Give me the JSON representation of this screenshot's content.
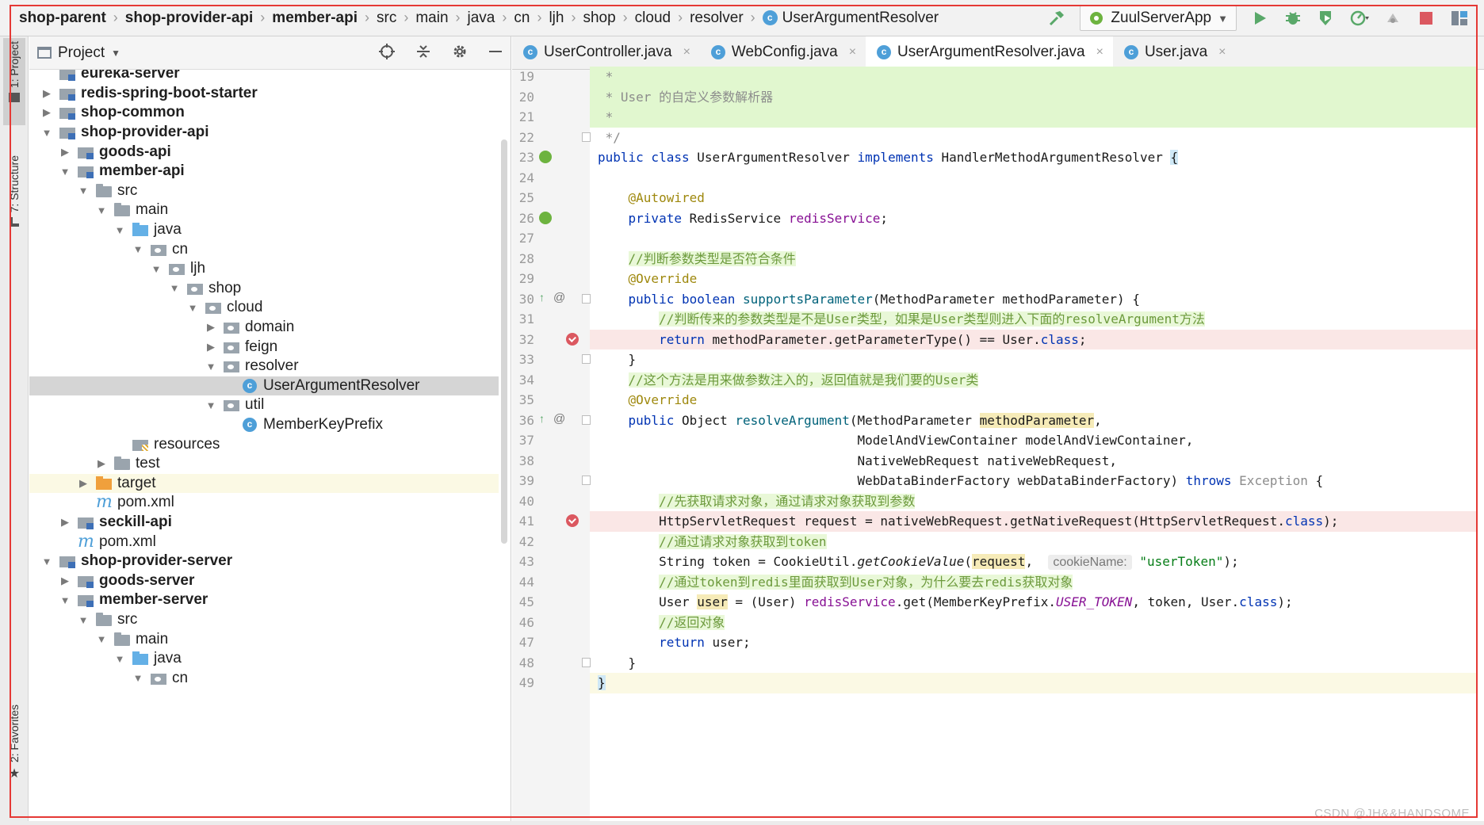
{
  "breadcrumb": [
    {
      "label": "shop-parent",
      "bold": true
    },
    {
      "label": "shop-provider-api",
      "bold": true
    },
    {
      "label": "member-api",
      "bold": true
    },
    {
      "label": "src",
      "bold": false
    },
    {
      "label": "main",
      "bold": false
    },
    {
      "label": "java",
      "bold": false
    },
    {
      "label": "cn",
      "bold": false
    },
    {
      "label": "ljh",
      "bold": false
    },
    {
      "label": "shop",
      "bold": false
    },
    {
      "label": "cloud",
      "bold": false
    },
    {
      "label": "resolver",
      "bold": false
    },
    {
      "label": "UserArgumentResolver",
      "bold": false,
      "icon": "class-icon"
    }
  ],
  "run_config": {
    "label": "ZuulServerApp"
  },
  "left_strip": {
    "project": "1: Project",
    "structure": "7: Structure",
    "favorites": "2: Favorites"
  },
  "project_panel": {
    "title": "Project"
  },
  "tree": [
    {
      "label": "eureka-server",
      "depth": 1,
      "icon": "module",
      "arrow": "",
      "bold": true
    },
    {
      "label": "redis-spring-boot-starter",
      "depth": 1,
      "icon": "module",
      "arrow": "▶",
      "bold": true
    },
    {
      "label": "shop-common",
      "depth": 1,
      "icon": "module",
      "arrow": "▶",
      "bold": true
    },
    {
      "label": "shop-provider-api",
      "depth": 1,
      "icon": "module",
      "arrow": "▼",
      "bold": true
    },
    {
      "label": "goods-api",
      "depth": 2,
      "icon": "module",
      "arrow": "▶",
      "bold": true
    },
    {
      "label": "member-api",
      "depth": 2,
      "icon": "module",
      "arrow": "▼",
      "bold": true
    },
    {
      "label": "src",
      "depth": 3,
      "icon": "folder",
      "arrow": "▼",
      "bold": false
    },
    {
      "label": "main",
      "depth": 4,
      "icon": "folder",
      "arrow": "▼",
      "bold": false
    },
    {
      "label": "java",
      "depth": 5,
      "icon": "src",
      "arrow": "▼",
      "bold": false
    },
    {
      "label": "cn",
      "depth": 6,
      "icon": "pkg",
      "arrow": "▼",
      "bold": false
    },
    {
      "label": "ljh",
      "depth": 7,
      "icon": "pkg",
      "arrow": "▼",
      "bold": false
    },
    {
      "label": "shop",
      "depth": 8,
      "icon": "pkg",
      "arrow": "▼",
      "bold": false
    },
    {
      "label": "cloud",
      "depth": 9,
      "icon": "pkg",
      "arrow": "▼",
      "bold": false
    },
    {
      "label": "domain",
      "depth": 10,
      "icon": "pkg",
      "arrow": "▶",
      "bold": false
    },
    {
      "label": "feign",
      "depth": 10,
      "icon": "pkg",
      "arrow": "▶",
      "bold": false
    },
    {
      "label": "resolver",
      "depth": 10,
      "icon": "pkg",
      "arrow": "▼",
      "bold": false
    },
    {
      "label": "UserArgumentResolver",
      "depth": 11,
      "icon": "cls",
      "arrow": "",
      "bold": false,
      "selected": true
    },
    {
      "label": "util",
      "depth": 10,
      "icon": "pkg",
      "arrow": "▼",
      "bold": false
    },
    {
      "label": "MemberKeyPrefix",
      "depth": 11,
      "icon": "cls",
      "arrow": "",
      "bold": false
    },
    {
      "label": "resources",
      "depth": 5,
      "icon": "res",
      "arrow": "",
      "bold": false
    },
    {
      "label": "test",
      "depth": 4,
      "icon": "folder",
      "arrow": "▶",
      "bold": false
    },
    {
      "label": "target",
      "depth": 3,
      "icon": "orange",
      "arrow": "▶",
      "bold": false,
      "target": true
    },
    {
      "label": "pom.xml",
      "depth": 3,
      "icon": "mvn",
      "arrow": "",
      "bold": false
    },
    {
      "label": "seckill-api",
      "depth": 2,
      "icon": "module",
      "arrow": "▶",
      "bold": true
    },
    {
      "label": "pom.xml",
      "depth": 2,
      "icon": "mvn",
      "arrow": "",
      "bold": false
    },
    {
      "label": "shop-provider-server",
      "depth": 1,
      "icon": "module",
      "arrow": "▼",
      "bold": true
    },
    {
      "label": "goods-server",
      "depth": 2,
      "icon": "module",
      "arrow": "▶",
      "bold": true
    },
    {
      "label": "member-server",
      "depth": 2,
      "icon": "module",
      "arrow": "▼",
      "bold": true
    },
    {
      "label": "src",
      "depth": 3,
      "icon": "folder",
      "arrow": "▼",
      "bold": false
    },
    {
      "label": "main",
      "depth": 4,
      "icon": "folder",
      "arrow": "▼",
      "bold": false
    },
    {
      "label": "java",
      "depth": 5,
      "icon": "src",
      "arrow": "▼",
      "bold": false
    },
    {
      "label": "cn",
      "depth": 6,
      "icon": "pkg",
      "arrow": "▼",
      "bold": false
    }
  ],
  "tabs": [
    {
      "label": "UserController.java",
      "active": false
    },
    {
      "label": "WebConfig.java",
      "active": false
    },
    {
      "label": "UserArgumentResolver.java",
      "active": true
    },
    {
      "label": "User.java",
      "active": false
    }
  ],
  "code_lines": [
    {
      "n": "19",
      "bg": "green",
      "parts": [
        [
          "cm",
          " *"
        ]
      ]
    },
    {
      "n": "20",
      "bg": "green",
      "parts": [
        [
          "cm",
          " * User 的自定义参数解析器"
        ]
      ]
    },
    {
      "n": "21",
      "bg": "green",
      "parts": [
        [
          "cm",
          " *"
        ]
      ]
    },
    {
      "n": "22",
      "bg": "",
      "fold": true,
      "parts": [
        [
          "cm",
          " */"
        ]
      ]
    },
    {
      "n": "23",
      "bg": "",
      "gicon": "bean",
      "parts": [
        [
          "kw",
          "public class "
        ],
        [
          "",
          "UserArgumentResolver "
        ],
        [
          "kw",
          "implements "
        ],
        [
          "",
          "HandlerMethodArgumentResolver "
        ],
        [
          "brace",
          "{"
        ]
      ]
    },
    {
      "n": "24",
      "bg": "",
      "parts": []
    },
    {
      "n": "25",
      "bg": "",
      "parts": [
        [
          "",
          "    "
        ],
        [
          "an",
          "@Autowired"
        ]
      ]
    },
    {
      "n": "26",
      "bg": "",
      "gicon": "bean",
      "parts": [
        [
          "",
          "    "
        ],
        [
          "kw",
          "private "
        ],
        [
          "",
          "RedisService "
        ],
        [
          "fld",
          "redisService"
        ],
        [
          "",
          ";"
        ]
      ]
    },
    {
      "n": "27",
      "bg": "",
      "parts": []
    },
    {
      "n": "28",
      "bg": "",
      "parts": [
        [
          "",
          "    "
        ],
        [
          "cmg",
          "//判断参数类型是否符合条件"
        ]
      ]
    },
    {
      "n": "29",
      "bg": "",
      "parts": [
        [
          "",
          "    "
        ],
        [
          "an",
          "@Override"
        ]
      ]
    },
    {
      "n": "30",
      "bg": "",
      "gicon": "override",
      "fold": true,
      "parts": [
        [
          "",
          "    "
        ],
        [
          "kw",
          "public boolean "
        ],
        [
          "fn",
          "supportsParameter"
        ],
        [
          "",
          "(MethodParameter methodParameter) {"
        ]
      ]
    },
    {
      "n": "31",
      "bg": "",
      "parts": [
        [
          "",
          "        "
        ],
        [
          "cmg",
          "//判断传来的参数类型是不是User类型，如果是User类型则进入下面的resolveArgument方法"
        ]
      ]
    },
    {
      "n": "32",
      "bg": "red",
      "bp": true,
      "parts": [
        [
          "",
          "        "
        ],
        [
          "kw",
          "return "
        ],
        [
          "",
          "methodParameter.getParameterType() == User."
        ],
        [
          "kw",
          "class"
        ],
        [
          "",
          ";"
        ]
      ]
    },
    {
      "n": "33",
      "bg": "",
      "fold": true,
      "parts": [
        [
          "",
          "    }"
        ]
      ]
    },
    {
      "n": "34",
      "bg": "",
      "parts": [
        [
          "",
          "    "
        ],
        [
          "cmg",
          "//这个方法是用来做参数注入的，返回值就是我们要的User类"
        ]
      ]
    },
    {
      "n": "35",
      "bg": "",
      "parts": [
        [
          "",
          "    "
        ],
        [
          "an",
          "@Override"
        ]
      ]
    },
    {
      "n": "36",
      "bg": "",
      "gicon": "override",
      "fold": true,
      "parts": [
        [
          "",
          "    "
        ],
        [
          "kw",
          "public "
        ],
        [
          "",
          "Object "
        ],
        [
          "fn",
          "resolveArgument"
        ],
        [
          "",
          "(MethodParameter "
        ],
        [
          "hly",
          "methodParameter"
        ],
        [
          "",
          ","
        ]
      ]
    },
    {
      "n": "37",
      "bg": "",
      "parts": [
        [
          "",
          "                                  ModelAndViewContainer modelAndViewContainer,"
        ]
      ]
    },
    {
      "n": "38",
      "bg": "",
      "parts": [
        [
          "",
          "                                  NativeWebRequest nativeWebRequest,"
        ]
      ]
    },
    {
      "n": "39",
      "bg": "",
      "fold": true,
      "parts": [
        [
          "",
          "                                  WebDataBinderFactory webDataBinderFactory) "
        ],
        [
          "kw",
          "throws "
        ],
        [
          "cm",
          "Exception "
        ],
        [
          "",
          "{"
        ]
      ]
    },
    {
      "n": "40",
      "bg": "",
      "parts": [
        [
          "",
          "        "
        ],
        [
          "cmg",
          "//先获取请求对象，通过请求对象获取到参数"
        ]
      ]
    },
    {
      "n": "41",
      "bg": "red",
      "bp": true,
      "parts": [
        [
          "",
          "        HttpServletRequest request = nativeWebRequest.getNativeRequest(HttpServletRequest."
        ],
        [
          "kw",
          "class"
        ],
        [
          "",
          ");"
        ]
      ]
    },
    {
      "n": "42",
      "bg": "",
      "parts": [
        [
          "",
          "        "
        ],
        [
          "cmg",
          "//通过请求对象获取到token"
        ]
      ]
    },
    {
      "n": "43",
      "bg": "",
      "parts": [
        [
          "",
          "        String token = CookieUtil."
        ],
        [
          "it",
          "getCookieValue"
        ],
        [
          "",
          "("
        ],
        [
          "hly",
          "request"
        ],
        [
          "",
          ",  "
        ],
        [
          "hint",
          "cookieName:"
        ],
        [
          "",
          " "
        ],
        [
          "str",
          "\"userToken\""
        ],
        [
          "",
          ");"
        ]
      ]
    },
    {
      "n": "44",
      "bg": "",
      "parts": [
        [
          "",
          "        "
        ],
        [
          "cmg",
          "//通过token到redis里面获取到User对象，为什么要去redis获取对象"
        ]
      ]
    },
    {
      "n": "45",
      "bg": "",
      "parts": [
        [
          "",
          "        User "
        ],
        [
          "hly",
          "user"
        ],
        [
          "",
          " = (User) "
        ],
        [
          "fld",
          "redisService"
        ],
        [
          "",
          ".get(MemberKeyPrefix."
        ],
        [
          "st",
          "USER_TOKEN"
        ],
        [
          "",
          ", token, User."
        ],
        [
          "kw",
          "class"
        ],
        [
          "",
          ");"
        ]
      ]
    },
    {
      "n": "46",
      "bg": "",
      "parts": [
        [
          "",
          "        "
        ],
        [
          "cmg",
          "//返回对象"
        ]
      ]
    },
    {
      "n": "47",
      "bg": "",
      "parts": [
        [
          "",
          "        "
        ],
        [
          "kw",
          "return "
        ],
        [
          "",
          "user;"
        ]
      ]
    },
    {
      "n": "48",
      "bg": "",
      "fold": true,
      "parts": [
        [
          "",
          "    }"
        ]
      ]
    },
    {
      "n": "49",
      "bg": "yellow",
      "parts": [
        [
          "brace",
          "}"
        ]
      ]
    }
  ],
  "watermark": "CSDN @JH&&HANDSOME"
}
